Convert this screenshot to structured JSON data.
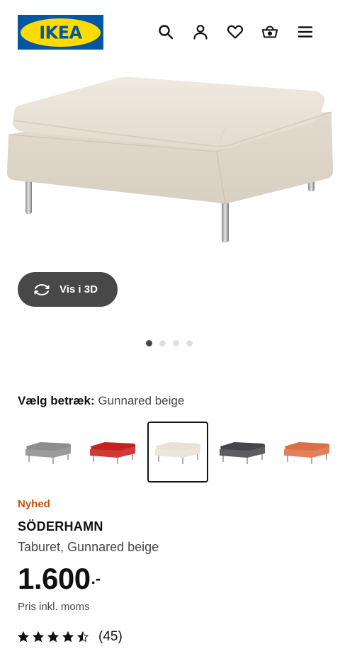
{
  "header": {
    "logo_text": "IKEA",
    "icons": [
      "search-icon",
      "user-icon",
      "heart-icon",
      "basket-icon",
      "menu-icon"
    ]
  },
  "gallery": {
    "view_3d_label": "Vis i 3D",
    "image_count": 4,
    "active_image": 1
  },
  "cover": {
    "label": "Vælg betræk:",
    "selected": "Gunnared beige",
    "swatches": [
      {
        "color": "#8d8d8d"
      },
      {
        "color": "#c8201e"
      },
      {
        "color": "#e8e1d5",
        "selected": true
      },
      {
        "color": "#45464b"
      },
      {
        "color": "#dd6e45"
      }
    ]
  },
  "product": {
    "badge": "Nyhed",
    "name": "SÖDERHAMN",
    "description": "Taburet, Gunnared beige",
    "price": "1.600",
    "price_suffix": ".-",
    "vat_note": "Pris inkl. moms",
    "rating": 4.5,
    "review_count": "(45)"
  },
  "colors": {
    "brand_blue": "#0058a3",
    "brand_yellow": "#ffdb00",
    "badge_orange": "#ca5008"
  }
}
